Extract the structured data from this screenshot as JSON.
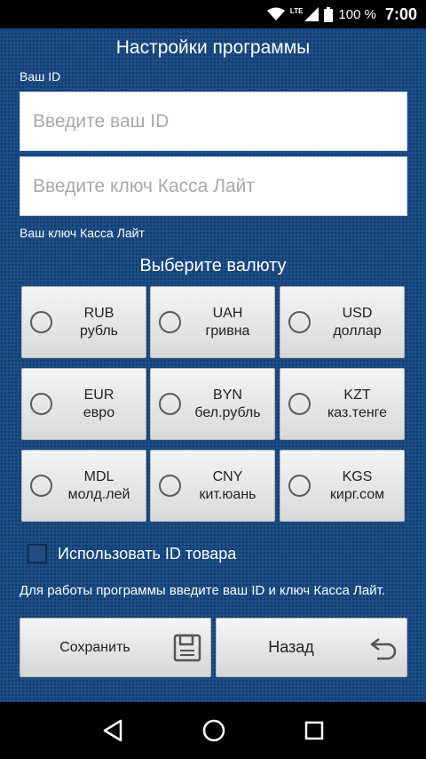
{
  "status_bar": {
    "network": "LTE",
    "battery": "100 %",
    "time": "7:00"
  },
  "header": {
    "title": "Настройки программы"
  },
  "id_section": {
    "label": "Ваш ID",
    "placeholder": "Введите ваш ID"
  },
  "key_section": {
    "placeholder": "Введите ключ Касса Лайт",
    "label": "Ваш ключ Касса Лайт"
  },
  "currency": {
    "title": "Выберите валюту",
    "options": [
      {
        "code": "RUB",
        "name": "рубль"
      },
      {
        "code": "UAH",
        "name": "гривна"
      },
      {
        "code": "USD",
        "name": "доллар"
      },
      {
        "code": "EUR",
        "name": "евро"
      },
      {
        "code": "BYN",
        "name": "бел.рубль"
      },
      {
        "code": "KZT",
        "name": "каз.тенге"
      },
      {
        "code": "MDL",
        "name": "молд.лей"
      },
      {
        "code": "CNY",
        "name": "кит.юань"
      },
      {
        "code": "KGS",
        "name": "кирг.сом"
      }
    ]
  },
  "use_product_id": {
    "label": "Использовать ID товара",
    "checked": false
  },
  "hint": "Для работы программы введите ваш ID и ключ Касса Лайт.",
  "actions": {
    "save_label": "Сохранить",
    "back_label": "Назад"
  },
  "icons": {
    "save": "floppy-disk-icon",
    "back": "undo-arrow-icon",
    "nav_back": "triangle-back-icon",
    "nav_home": "circle-home-icon",
    "nav_recents": "square-recents-icon"
  },
  "colors": {
    "background": "#1c4e87",
    "button_gradient_top": "#f4f4f4",
    "button_gradient_bottom": "#d9d9d9"
  }
}
